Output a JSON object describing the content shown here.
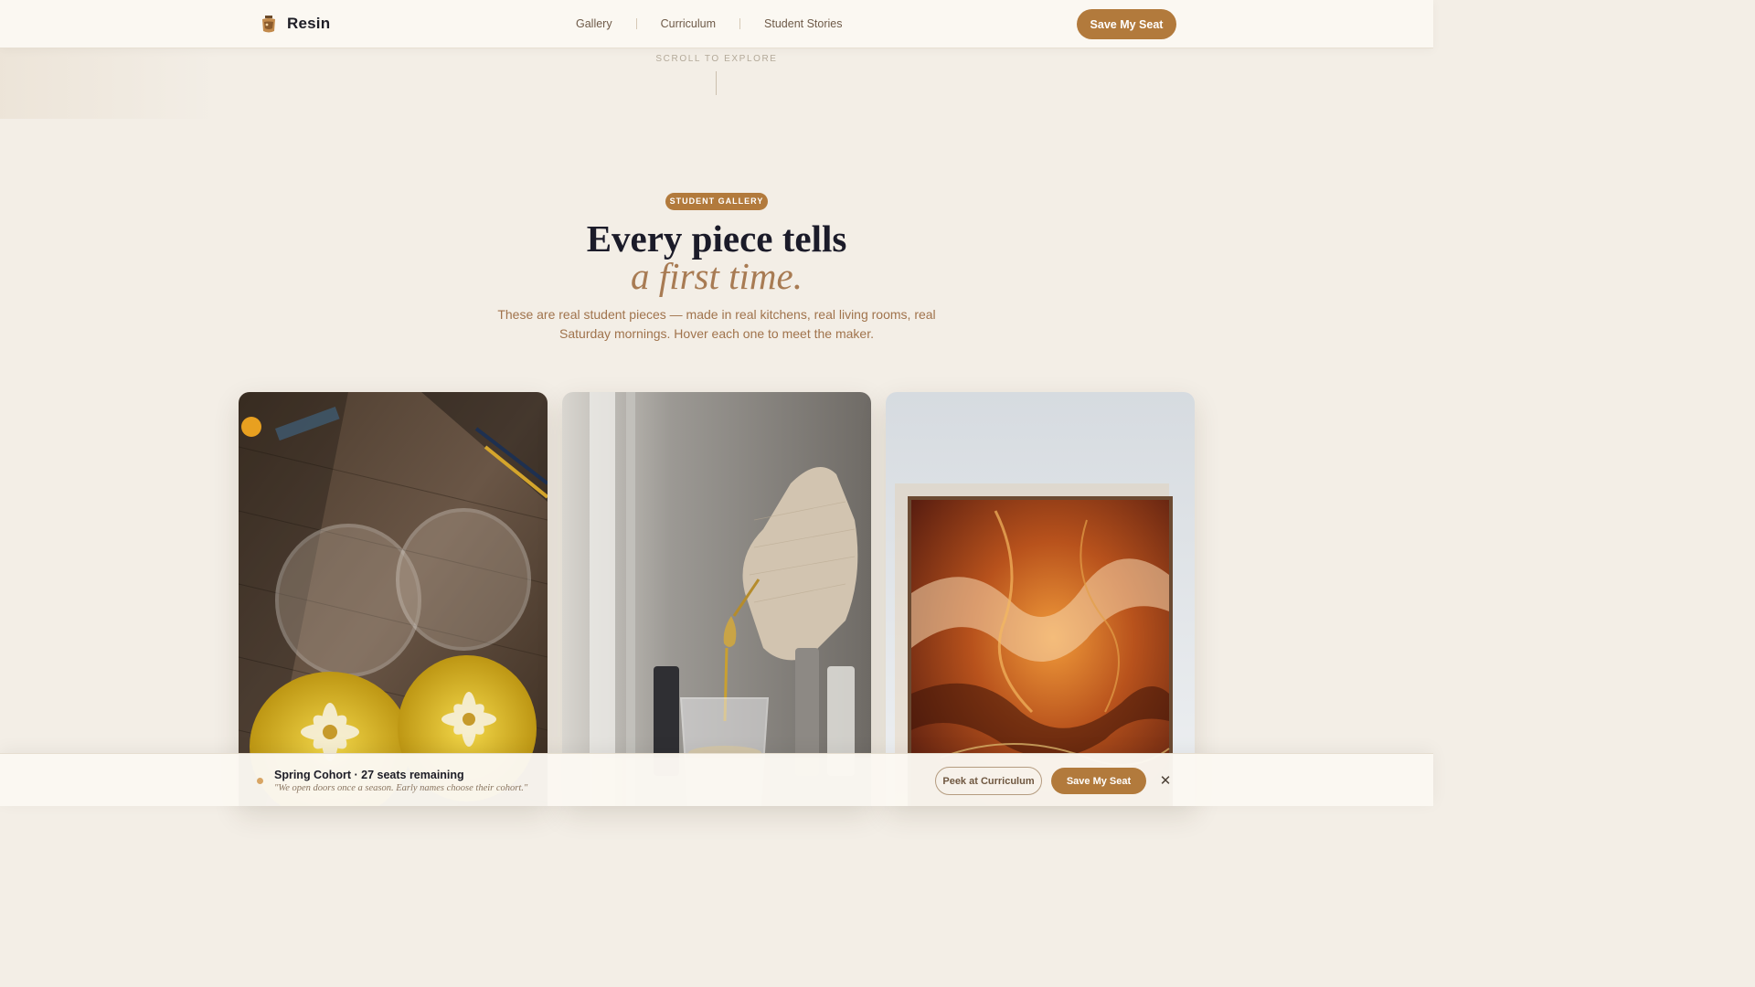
{
  "header": {
    "brand_name": "Resin",
    "nav": [
      {
        "label": "Gallery"
      },
      {
        "label": "Curriculum"
      },
      {
        "label": "Student Stories"
      }
    ],
    "cta_label": "Save My Seat"
  },
  "scroll_hint": "SCROLL TO EXPLORE",
  "hero": {
    "badge": "STUDENT GALLERY",
    "headline": "Every piece tells",
    "headline_accent": "a first time.",
    "subcopy": "These are real student pieces — made in real kitchens, real living rooms, real Saturday mornings. Hover each one to meet the maker."
  },
  "gallery": {
    "cards": [
      {
        "image": "resin-coasters-with-dried-flowers"
      },
      {
        "image": "gloved-hand-pouring-gold-pigment"
      },
      {
        "image": "framed-orange-resin-art"
      }
    ]
  },
  "bottom_bar": {
    "title": "Spring Cohort · 27 seats remaining",
    "quote": "\"We open doors once a season. Early names choose their cohort.\"",
    "secondary_label": "Peek at Curriculum",
    "primary_label": "Save My Seat",
    "close_icon": "close-icon"
  },
  "colors": {
    "accent": "#b27a3c",
    "background": "#f3eee6",
    "headline": "#1b1b29",
    "headline_accent": "#a87b53"
  }
}
